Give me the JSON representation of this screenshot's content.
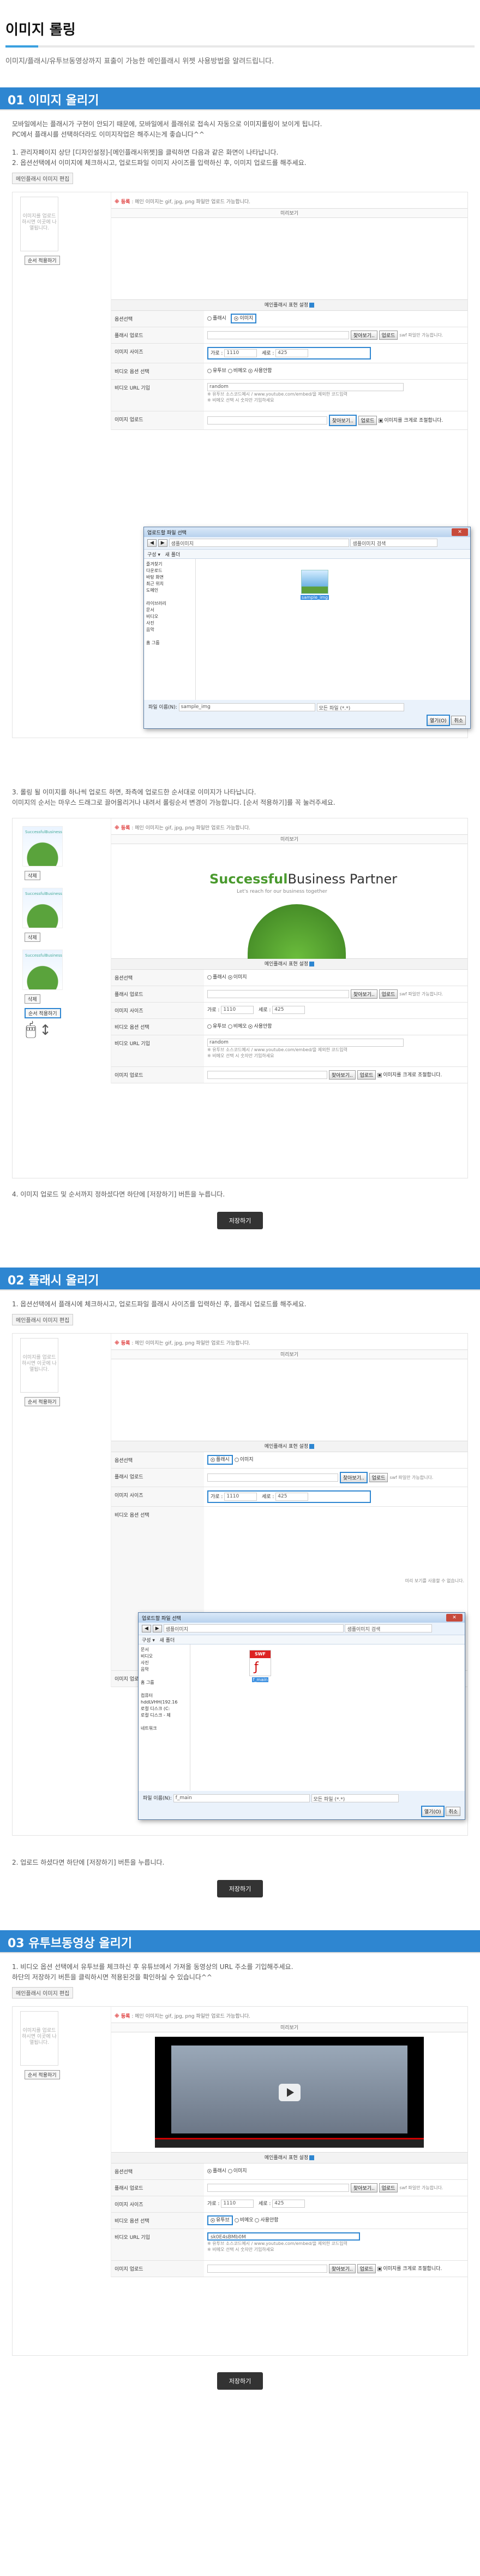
{
  "page_title": "이미지 롤링",
  "page_desc": "이미지/플래시/유투브동영상까지 표출이 가능한 메인플래시 위젯 사용방법을 알려드립니다.",
  "s1": {
    "title": "01 이미지 올리기",
    "p1": "모바일에서는 플래시가 구현이 안되기 때문에, 모바일에서 플래쉬로 접속시 자동으로 이미지롤링이 보이게 됩니다.",
    "p2": "PC에서 플래시를 선택하더라도 이미지작업은 해주시는게 좋습니다^^",
    "p3": "1. 관리자페이지 상단 [디자인설정]-[메인플래시위젯]을 클릭하면 다음과 같은 화면이 나타납니다.",
    "p4": "2. 옵션선택에서 이미지에 체크하시고, 업로드파일 이미지 사이즈를 입력하신 후, 이미지 업로드를 해주세요.",
    "step4": "4. 이미지 업로드 및 순서까지 정하셨다면 하단에 [저장하기] 버튼을 누릅니다."
  },
  "s1b": {
    "p1": "3. 롤링 될 이미지를 하나씩 업로드 하면, 좌측에 업로드한 순서대로 이미지가 나타납니다.",
    "p2": "이미지의 순서는 마우스 드래그로 끌어올리거나 내려서 롤링순서 변경이 가능합니다. [순서 적용하기]를 꼭 눌러주세요."
  },
  "s2": {
    "title": "02 플래시 올리기",
    "p1": "1. 옵션선택에서 플래시에 체크하시고, 업로드파일 플래시 사이즈를 입력하신 후, 플래시 업로드를 해주세요.",
    "p2": "2. 업로드 하셨다면  하단에 [저장하기] 버튼을 누릅니다."
  },
  "s3": {
    "title": "03 유투브동영상 올리기",
    "p1": "1. 비디오 옵션 선택에서 유투브를 체크하신 후  유튜브에서 가져올 동영상의 URL 주소를 기입해주세요.",
    "p2": "하단의 저장하기 버튼을 클릭하시면 적용된것을 확인하실 수 있습니다^^"
  },
  "ui": {
    "widget_tag": "메인플래시 이미지 편집",
    "thumb_text": "이미지를 업로드하시면 이곳에 나열됩니다.",
    "order_btn": "순서 적용하기",
    "notice_label": "※ 등록",
    "notice": ": 메인 이미지는 gif, jpg, png 파일만 업로드 가능합니다.",
    "preview": "미리보기",
    "options": "메인플래시 표현 설정",
    "lbl_opt": "옵션선택",
    "lbl_flash": "플래시 업로드",
    "lbl_size": "이미지 사이즈",
    "lbl_vopt": "비디오 옵션 선택",
    "lbl_vurl": "비디오 URL 기입",
    "lbl_img": "이미지 업로드",
    "opt_flash": "플래시",
    "opt_image": "이미지",
    "find": "찾아보기..",
    "upload": "업로드",
    "swf_note": "swf 파일만 가능합니다.",
    "w_label": "가로 :",
    "w_val": "1110",
    "h_label": "세로 :",
    "h_val": "425",
    "v_youtube": "유투브",
    "v_vimeo": "비메오",
    "v_none": "사용안함",
    "url_note": "※ 유투브 소스코드예시 / www.youtube.com/embed/",
    "url_note2": "을 제외한 코드입력",
    "url_warn": "※ 비메오 선택 시 숫자만 기입하세요",
    "random": "random",
    "img_check": "이미지를 크게로 조절합니다.",
    "save": "저장하기",
    "yt_val": "sk0E4sBMb0M",
    "dlg_title": "업로드할 파일 선택",
    "dlg_path1": "샘플이미지",
    "dlg_path2": "샘플이미지",
    "dlg_search": "샘플이미지 검색",
    "dlg_org": "구성 ▾",
    "dlg_newf": "새 폴더",
    "side1": [
      "즐겨찾기",
      "다운로드",
      "바탕 화면",
      "최근 위치",
      "도메인",
      "",
      "라이브러리",
      "문서",
      "비디오",
      "사진",
      "음악",
      "",
      "홈 그룹"
    ],
    "side2": [
      "문서",
      "비디오",
      "사진",
      "음악",
      "",
      "홈 그룹",
      "",
      "컴퓨터",
      "hddLVHH(192.16",
      "로컬 디스크 (C:",
      "로컬 디스크 - 제",
      "",
      "네트워크"
    ],
    "fn_label": "파일 이름(N):",
    "fn1": "sample_img",
    "fn2": "f_main",
    "filter": "모든 파일 (*.*)",
    "open": "열기(O)",
    "cancel": "취소",
    "file1": "sample_img",
    "file2": "f_main",
    "swf": "SWF",
    "banner_a": "Successful",
    "banner_b": "Business Partner",
    "banner_sub": "Let's reach for our business together",
    "preview_side": "미리 보기를 사용할 수 없습니다."
  }
}
